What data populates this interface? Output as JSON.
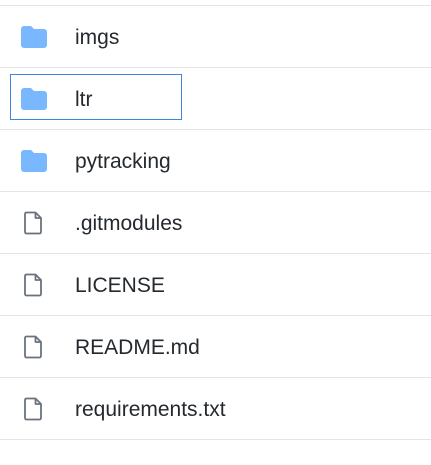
{
  "files": [
    {
      "name": "imgs",
      "type": "folder",
      "icon": "folder-icon"
    },
    {
      "name": "ltr",
      "type": "folder",
      "icon": "folder-icon",
      "focused": true
    },
    {
      "name": "pytracking",
      "type": "folder",
      "icon": "folder-icon"
    },
    {
      "name": ".gitmodules",
      "type": "file",
      "icon": "file-icon"
    },
    {
      "name": "LICENSE",
      "type": "file",
      "icon": "file-icon"
    },
    {
      "name": "README.md",
      "type": "file",
      "icon": "file-icon"
    },
    {
      "name": "requirements.txt",
      "type": "file",
      "icon": "file-icon"
    }
  ],
  "colors": {
    "folder": "#79b8ff",
    "file_stroke": "#6a737d",
    "text": "#24292e",
    "divider": "#e1e4e8",
    "focus": "#3f87d9"
  }
}
